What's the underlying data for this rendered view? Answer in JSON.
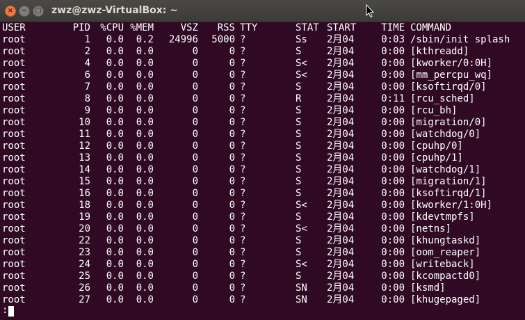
{
  "window": {
    "title": "zwz@zwz-VirtualBox: ~",
    "buttons": {
      "close": "×",
      "minimize": "−",
      "maximize": "□"
    }
  },
  "terminal": {
    "header": {
      "user": "USER",
      "pid": "PID",
      "cpu": "%CPU",
      "mem": "%MEM",
      "vsz": "VSZ",
      "rss": "RSS",
      "tty": "TTY",
      "stat": "STAT",
      "start": "START",
      "time": "TIME",
      "command": "COMMAND"
    },
    "rows": [
      {
        "user": "root",
        "pid": "1",
        "cpu": "0.0",
        "mem": "0.2",
        "vsz": "24996",
        "rss": "5000",
        "tty": "?",
        "stat": "Ss",
        "start": "2月04",
        "time": "0:03",
        "command": "/sbin/init splash"
      },
      {
        "user": "root",
        "pid": "2",
        "cpu": "0.0",
        "mem": "0.0",
        "vsz": "0",
        "rss": "0",
        "tty": "?",
        "stat": "S",
        "start": "2月04",
        "time": "0:00",
        "command": "[kthreadd]"
      },
      {
        "user": "root",
        "pid": "4",
        "cpu": "0.0",
        "mem": "0.0",
        "vsz": "0",
        "rss": "0",
        "tty": "?",
        "stat": "S<",
        "start": "2月04",
        "time": "0:00",
        "command": "[kworker/0:0H]"
      },
      {
        "user": "root",
        "pid": "6",
        "cpu": "0.0",
        "mem": "0.0",
        "vsz": "0",
        "rss": "0",
        "tty": "?",
        "stat": "S<",
        "start": "2月04",
        "time": "0:00",
        "command": "[mm_percpu_wq]"
      },
      {
        "user": "root",
        "pid": "7",
        "cpu": "0.0",
        "mem": "0.0",
        "vsz": "0",
        "rss": "0",
        "tty": "?",
        "stat": "S",
        "start": "2月04",
        "time": "0:00",
        "command": "[ksoftirqd/0]"
      },
      {
        "user": "root",
        "pid": "8",
        "cpu": "0.0",
        "mem": "0.0",
        "vsz": "0",
        "rss": "0",
        "tty": "?",
        "stat": "R",
        "start": "2月04",
        "time": "0:11",
        "command": "[rcu_sched]"
      },
      {
        "user": "root",
        "pid": "9",
        "cpu": "0.0",
        "mem": "0.0",
        "vsz": "0",
        "rss": "0",
        "tty": "?",
        "stat": "S",
        "start": "2月04",
        "time": "0:00",
        "command": "[rcu_bh]"
      },
      {
        "user": "root",
        "pid": "10",
        "cpu": "0.0",
        "mem": "0.0",
        "vsz": "0",
        "rss": "0",
        "tty": "?",
        "stat": "S",
        "start": "2月04",
        "time": "0:00",
        "command": "[migration/0]"
      },
      {
        "user": "root",
        "pid": "11",
        "cpu": "0.0",
        "mem": "0.0",
        "vsz": "0",
        "rss": "0",
        "tty": "?",
        "stat": "S",
        "start": "2月04",
        "time": "0:00",
        "command": "[watchdog/0]"
      },
      {
        "user": "root",
        "pid": "12",
        "cpu": "0.0",
        "mem": "0.0",
        "vsz": "0",
        "rss": "0",
        "tty": "?",
        "stat": "S",
        "start": "2月04",
        "time": "0:00",
        "command": "[cpuhp/0]"
      },
      {
        "user": "root",
        "pid": "13",
        "cpu": "0.0",
        "mem": "0.0",
        "vsz": "0",
        "rss": "0",
        "tty": "?",
        "stat": "S",
        "start": "2月04",
        "time": "0:00",
        "command": "[cpuhp/1]"
      },
      {
        "user": "root",
        "pid": "14",
        "cpu": "0.0",
        "mem": "0.0",
        "vsz": "0",
        "rss": "0",
        "tty": "?",
        "stat": "S",
        "start": "2月04",
        "time": "0:00",
        "command": "[watchdog/1]"
      },
      {
        "user": "root",
        "pid": "15",
        "cpu": "0.0",
        "mem": "0.0",
        "vsz": "0",
        "rss": "0",
        "tty": "?",
        "stat": "S",
        "start": "2月04",
        "time": "0:00",
        "command": "[migration/1]"
      },
      {
        "user": "root",
        "pid": "16",
        "cpu": "0.0",
        "mem": "0.0",
        "vsz": "0",
        "rss": "0",
        "tty": "?",
        "stat": "S",
        "start": "2月04",
        "time": "0:00",
        "command": "[ksoftirqd/1]"
      },
      {
        "user": "root",
        "pid": "18",
        "cpu": "0.0",
        "mem": "0.0",
        "vsz": "0",
        "rss": "0",
        "tty": "?",
        "stat": "S<",
        "start": "2月04",
        "time": "0:00",
        "command": "[kworker/1:0H]"
      },
      {
        "user": "root",
        "pid": "19",
        "cpu": "0.0",
        "mem": "0.0",
        "vsz": "0",
        "rss": "0",
        "tty": "?",
        "stat": "S",
        "start": "2月04",
        "time": "0:00",
        "command": "[kdevtmpfs]"
      },
      {
        "user": "root",
        "pid": "20",
        "cpu": "0.0",
        "mem": "0.0",
        "vsz": "0",
        "rss": "0",
        "tty": "?",
        "stat": "S<",
        "start": "2月04",
        "time": "0:00",
        "command": "[netns]"
      },
      {
        "user": "root",
        "pid": "22",
        "cpu": "0.0",
        "mem": "0.0",
        "vsz": "0",
        "rss": "0",
        "tty": "?",
        "stat": "S",
        "start": "2月04",
        "time": "0:00",
        "command": "[khungtaskd]"
      },
      {
        "user": "root",
        "pid": "23",
        "cpu": "0.0",
        "mem": "0.0",
        "vsz": "0",
        "rss": "0",
        "tty": "?",
        "stat": "S",
        "start": "2月04",
        "time": "0:00",
        "command": "[oom_reaper]"
      },
      {
        "user": "root",
        "pid": "24",
        "cpu": "0.0",
        "mem": "0.0",
        "vsz": "0",
        "rss": "0",
        "tty": "?",
        "stat": "S<",
        "start": "2月04",
        "time": "0:00",
        "command": "[writeback]"
      },
      {
        "user": "root",
        "pid": "25",
        "cpu": "0.0",
        "mem": "0.0",
        "vsz": "0",
        "rss": "0",
        "tty": "?",
        "stat": "S",
        "start": "2月04",
        "time": "0:00",
        "command": "[kcompactd0]"
      },
      {
        "user": "root",
        "pid": "26",
        "cpu": "0.0",
        "mem": "0.0",
        "vsz": "0",
        "rss": "0",
        "tty": "?",
        "stat": "SN",
        "start": "2月04",
        "time": "0:00",
        "command": "[ksmd]"
      },
      {
        "user": "root",
        "pid": "27",
        "cpu": "0.0",
        "mem": "0.0",
        "vsz": "0",
        "rss": "0",
        "tty": "?",
        "stat": "SN",
        "start": "2月04",
        "time": "0:00",
        "command": "[khugepaged]"
      }
    ],
    "prompt": ":"
  },
  "colors": {
    "background": "#300a24",
    "foreground": "#ffffff",
    "titlebar": "#3c3b37",
    "close_button": "#f07746"
  }
}
